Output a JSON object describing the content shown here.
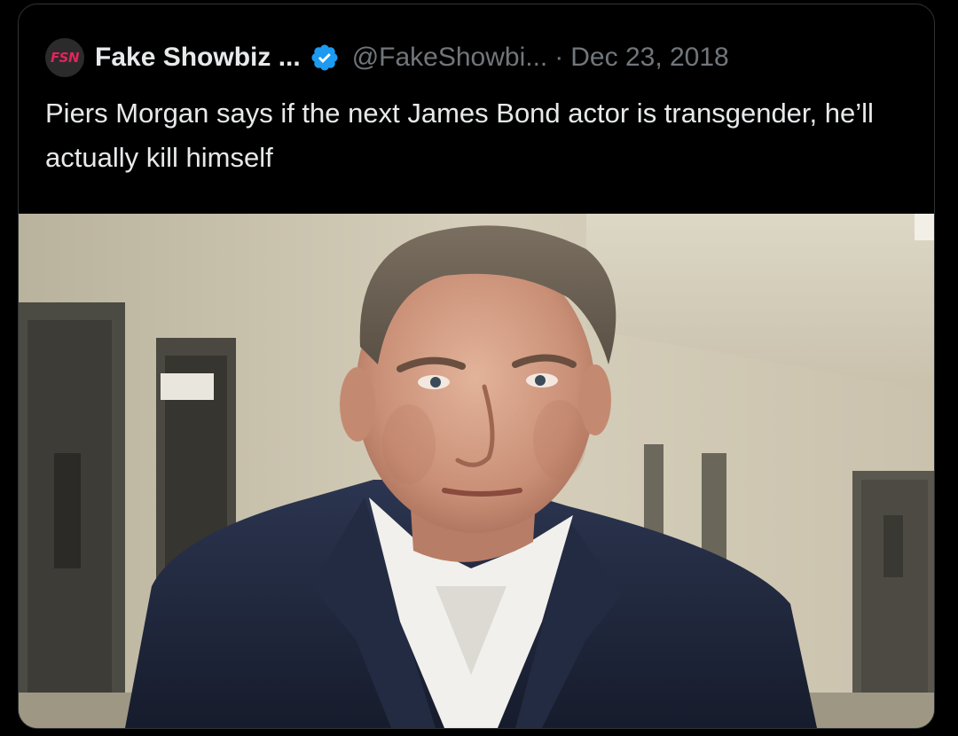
{
  "tweet": {
    "avatar_text": "FSN",
    "display_name": "Fake Showbiz ...",
    "verified_icon": "verified-badge-icon",
    "handle": "@FakeShowbi...",
    "separator": "·",
    "date": "Dec 23, 2018",
    "text": "Piers Morgan says if the next James Bond actor is transgender, he’ll actually kill himself"
  },
  "colors": {
    "background": "#000000",
    "text_primary": "#e7e9ea",
    "text_secondary": "#71767b",
    "verified_blue": "#1d9bf0",
    "avatar_accent": "#e0245e"
  }
}
